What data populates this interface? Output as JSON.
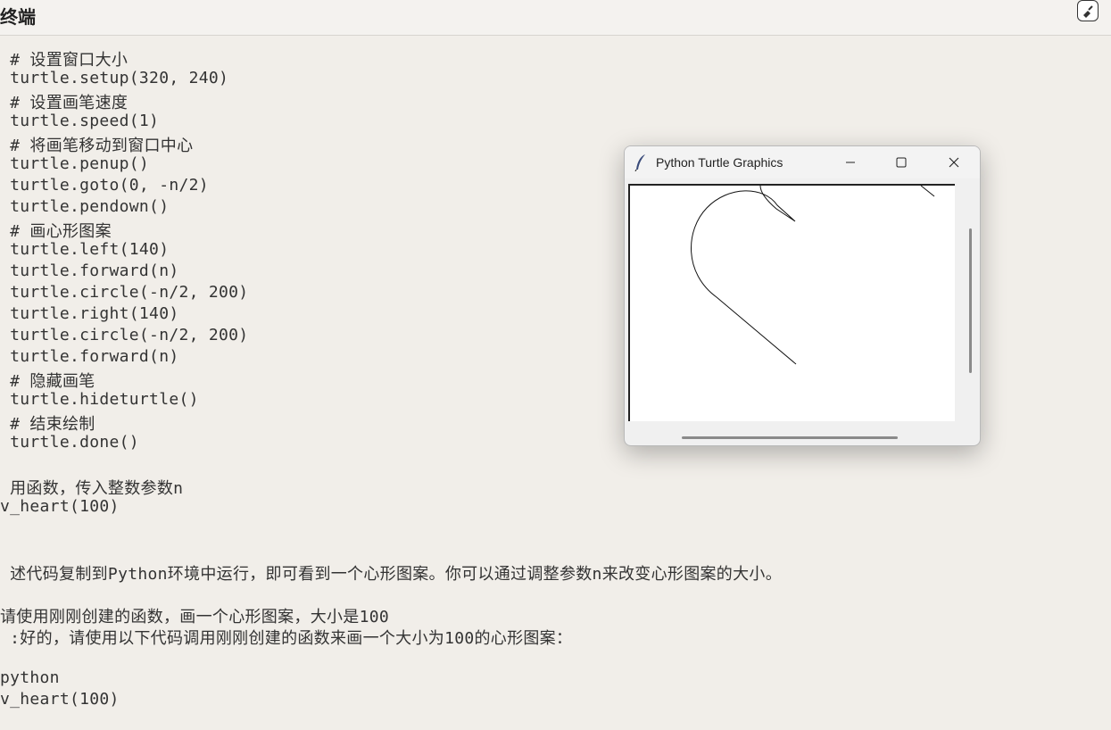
{
  "header": {
    "title": "终端"
  },
  "code_lines": [
    " # 设置窗口大小",
    " turtle.setup(320, 240)",
    " # 设置画笔速度",
    " turtle.speed(1)",
    " # 将画笔移动到窗口中心",
    " turtle.penup()",
    " turtle.goto(0, -n/2)",
    " turtle.pendown()",
    " # 画心形图案",
    " turtle.left(140)",
    " turtle.forward(n)",
    " turtle.circle(-n/2, 200)",
    " turtle.right(140)",
    " turtle.circle(-n/2, 200)",
    " turtle.forward(n)",
    " # 隐藏画笔",
    " turtle.hideturtle()",
    " # 结束绘制",
    " turtle.done()",
    "",
    " 用函数，传入整数参数n",
    "v_heart(100)",
    "",
    "",
    " 述代码复制到Python环境中运行，即可看到一个心形图案。你可以通过调整参数n来改变心形图案的大小。",
    "",
    "请使用刚刚创建的函数，画一个心形图案，大小是100",
    " :好的，请使用以下代码调用刚刚创建的函数来画一个大小为100的心形图案：",
    "",
    "python",
    "v_heart(100)"
  ],
  "turtle_window": {
    "title": "Python Turtle Graphics"
  }
}
